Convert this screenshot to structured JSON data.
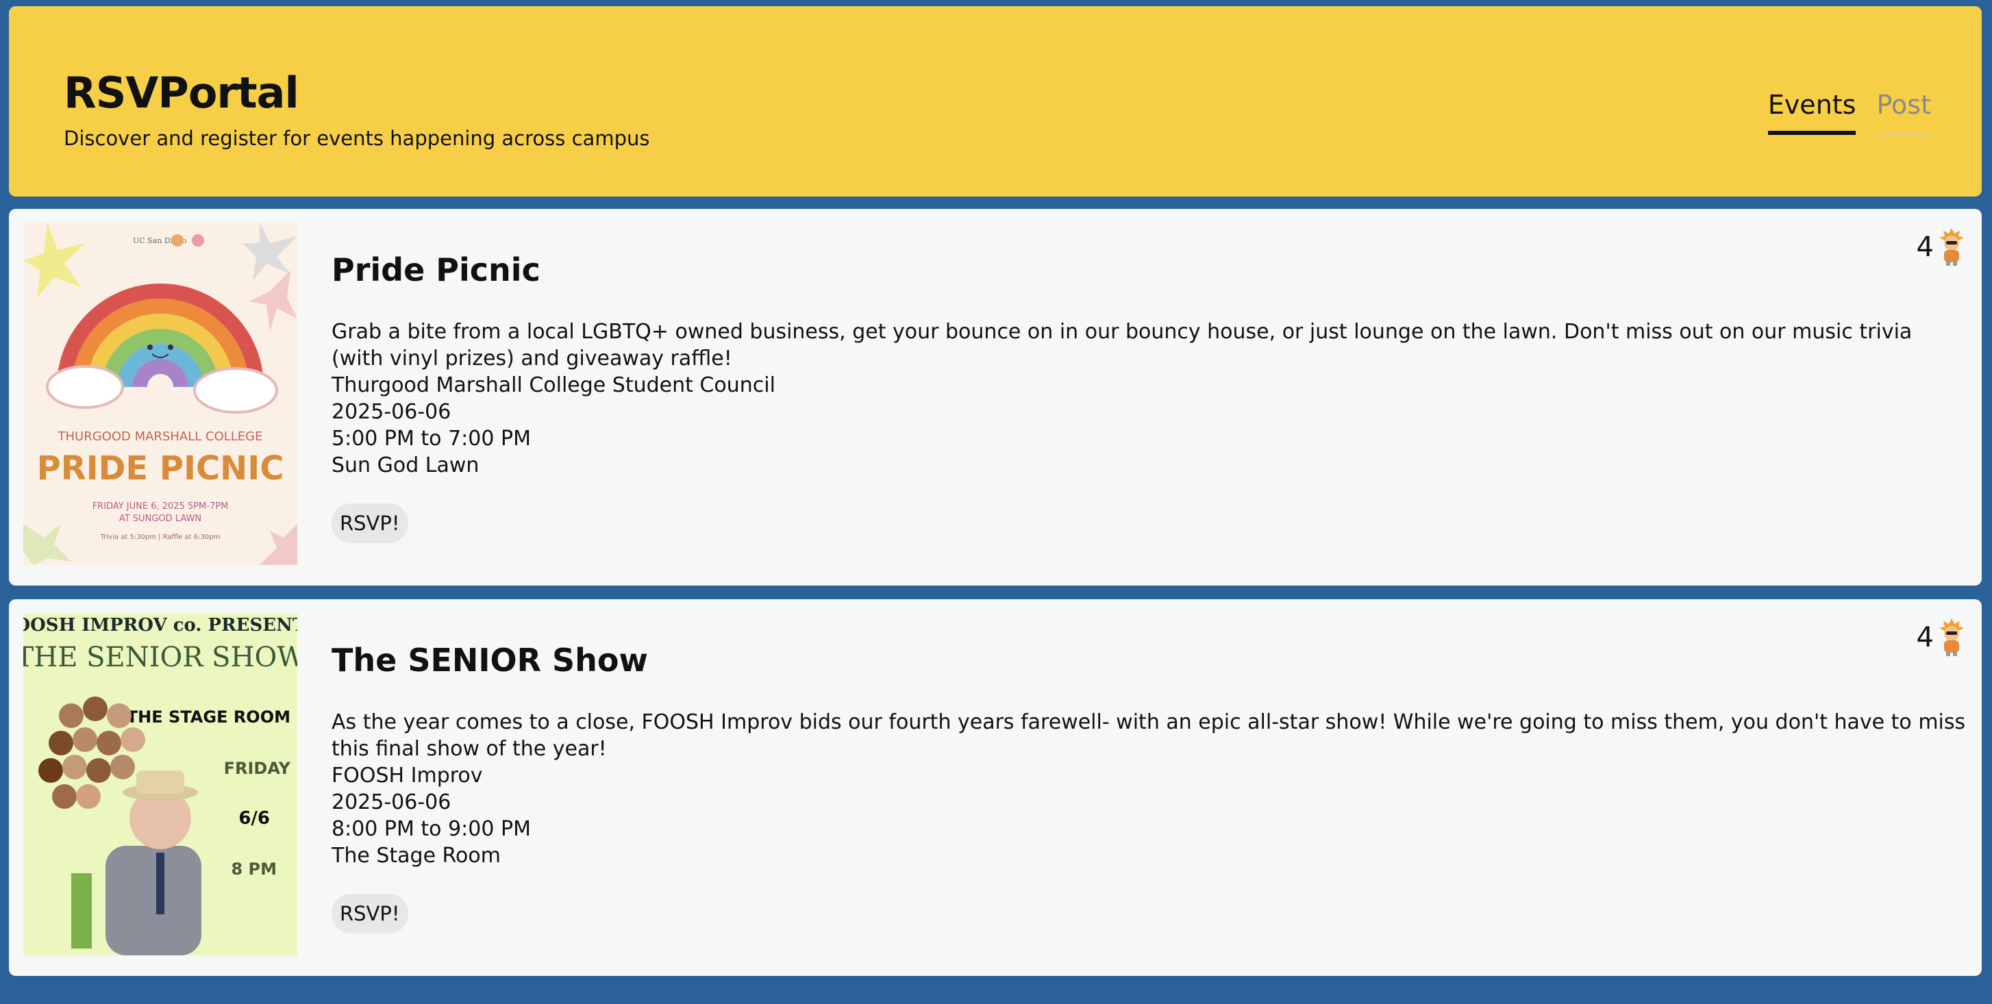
{
  "header": {
    "title": "RSVPortal",
    "subtitle": "Discover and register for events happening across campus",
    "tabs": [
      {
        "label": "Events",
        "active": true
      },
      {
        "label": "Post",
        "active": false
      }
    ]
  },
  "events": [
    {
      "title": "Pride Picnic",
      "description": "Grab a bite from a local LGBTQ+ owned business, get your bounce on in our bouncy house, or just lounge on the lawn. Don't miss out on our music trivia (with vinyl prizes) and giveaway raffle!",
      "organizer": "Thurgood Marshall College Student Council",
      "date": "2025-06-06",
      "time": "5:00 PM to 7:00 PM",
      "location": "Sun God Lawn",
      "rsvp_label": "RSVP!",
      "rsvp_count": "4",
      "poster": {
        "top_text": "UC San Diego",
        "college": "THURGOOD MARSHALL COLLEGE",
        "headline": "PRIDE PICNIC",
        "line1": "FRIDAY JUNE 6, 2025 5PM-7PM",
        "line2": "AT SUNGOD LAWN",
        "line3": "Trivia at 5:30pm | Raffle at 6:30pm"
      }
    },
    {
      "title": "The SENIOR Show",
      "description": "As the year comes to a close, FOOSH Improv bids our fourth years farewell- with an epic all-star show! While we're going to miss them, you don't have to miss this final show of the year!",
      "organizer": "FOOSH Improv",
      "date": "2025-06-06",
      "time": "8:00 PM to 9:00 PM",
      "location": "The Stage Room",
      "rsvp_label": "RSVP!",
      "rsvp_count": "4",
      "poster": {
        "top_text": "FOOSH IMPROV co. PRESENTS",
        "headline": "THE SENIOR SHOW",
        "venue": "THE STAGE ROOM",
        "day": "FRIDAY",
        "date": "6/6",
        "time": "8 PM"
      }
    }
  ],
  "colors": {
    "background": "#2a6199",
    "header": "#f7cf47",
    "card": "#f6f7f7",
    "button": "#e6e7e7"
  }
}
